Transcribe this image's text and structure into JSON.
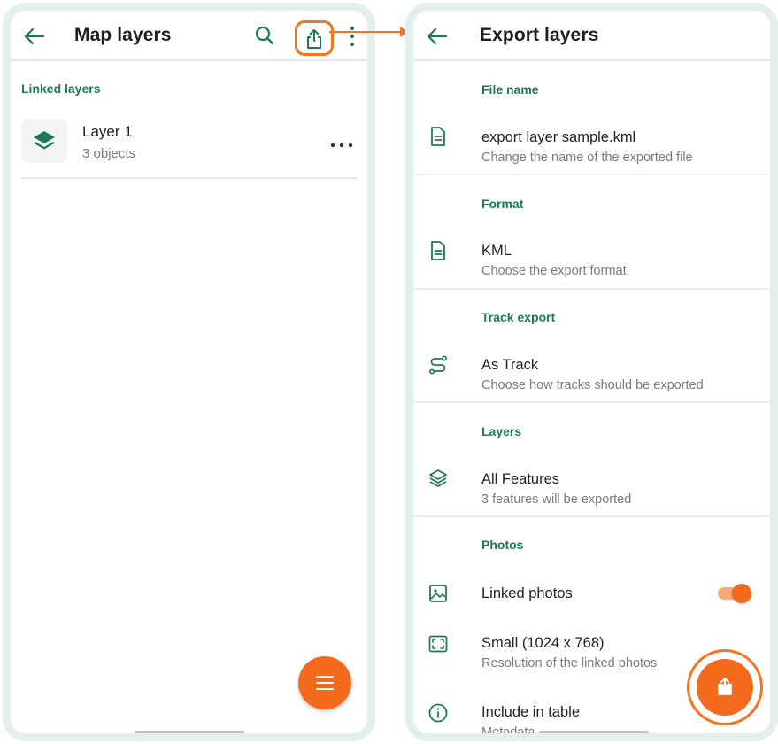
{
  "left_screen": {
    "title": "Map layers",
    "section_label": "Linked layers",
    "layer": {
      "name": "Layer 1",
      "count": "3 objects"
    },
    "icons": [
      "back-arrow-icon",
      "search-icon",
      "share-icon",
      "more-vert-icon",
      "layers-icon",
      "more-horiz-icon",
      "menu-icon"
    ]
  },
  "right_screen": {
    "title": "Export layers",
    "sections": {
      "file_name": "File name",
      "format": "Format",
      "track_export": "Track export",
      "layers": "Layers",
      "photos": "Photos"
    },
    "rows": {
      "file": {
        "title": "export layer sample.kml",
        "subtitle": "Change the name of the exported file"
      },
      "format": {
        "title": "KML",
        "subtitle": "Choose the export format"
      },
      "track": {
        "title": "As Track",
        "subtitle": "Choose how tracks should be exported"
      },
      "layers": {
        "title": "All Features",
        "subtitle": "3 features will be exported"
      },
      "linked_photos": {
        "title": "Linked photos",
        "enabled": true
      },
      "resolution": {
        "title": "Small (1024 x 768)",
        "subtitle": "Resolution of the linked photos"
      },
      "metadata": {
        "title": "Include in table",
        "subtitle": "Metadata"
      }
    }
  },
  "colors": {
    "accent": "#f36a1d",
    "highlight": "#f47521",
    "brand_green": "#1d7a52",
    "frame": "#e3efea"
  }
}
